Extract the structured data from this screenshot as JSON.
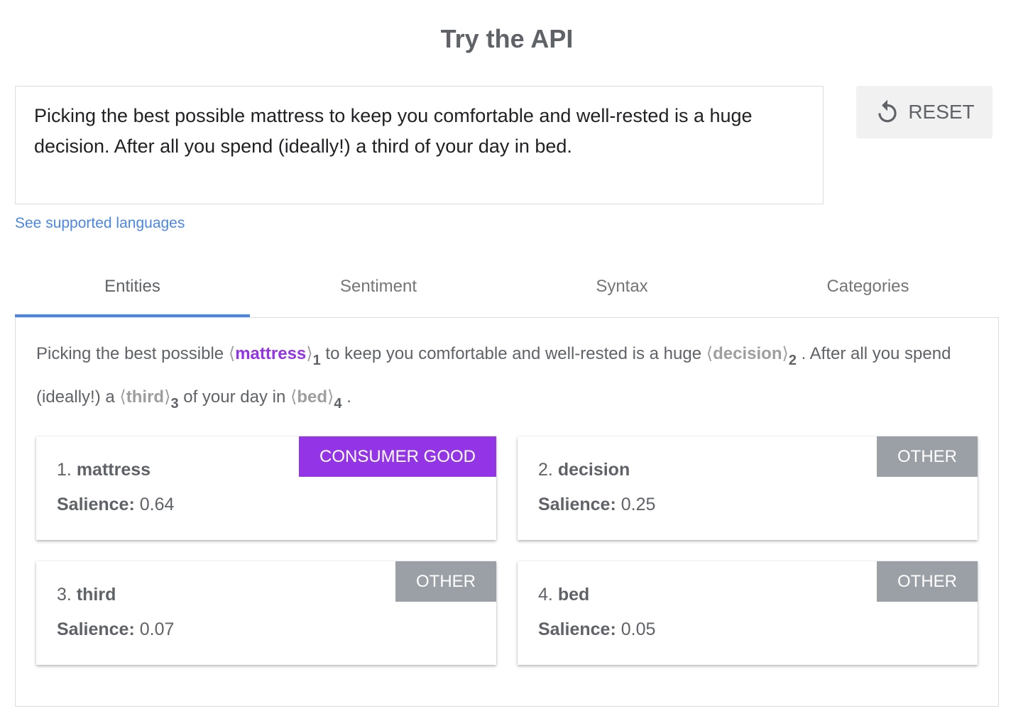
{
  "page": {
    "title": "Try the API"
  },
  "input": {
    "text": "Picking the best possible mattress to keep you comfortable and well-rested is a huge decision. After all you spend (ideally!) a third of your day in bed."
  },
  "reset": {
    "label": "RESET",
    "icon": "refresh-icon"
  },
  "languages_link": "See supported languages",
  "tabs": [
    {
      "label": "Entities",
      "active": true
    },
    {
      "label": "Sentiment",
      "active": false
    },
    {
      "label": "Syntax",
      "active": false
    },
    {
      "label": "Categories",
      "active": false
    }
  ],
  "annotated": {
    "seg0": "Picking the best possible ",
    "ent1": "mattress",
    "num1": "1",
    "seg1": " to keep you comfortable and well-rested is a huge ",
    "ent2": "decision",
    "num2": "2",
    "seg2": " . After all you spend (ideally!) a ",
    "ent3": "third",
    "num3": "3",
    "seg3": " of your day in ",
    "ent4": "bed",
    "num4": "4",
    "seg4": " ."
  },
  "salience_label": "Salience:",
  "entities": [
    {
      "index": "1.",
      "name": "mattress",
      "salience": "0.64",
      "type": "CONSUMER GOOD",
      "color": "#9334e6"
    },
    {
      "index": "2.",
      "name": "decision",
      "salience": "0.25",
      "type": "OTHER",
      "color": "#9aa0a6"
    },
    {
      "index": "3.",
      "name": "third",
      "salience": "0.07",
      "type": "OTHER",
      "color": "#9aa0a6"
    },
    {
      "index": "4.",
      "name": "bed",
      "salience": "0.05",
      "type": "OTHER",
      "color": "#9aa0a6"
    }
  ],
  "colors": {
    "accent": "#4a86e8",
    "consumer_good": "#9334e6",
    "other": "#9aa0a6"
  }
}
